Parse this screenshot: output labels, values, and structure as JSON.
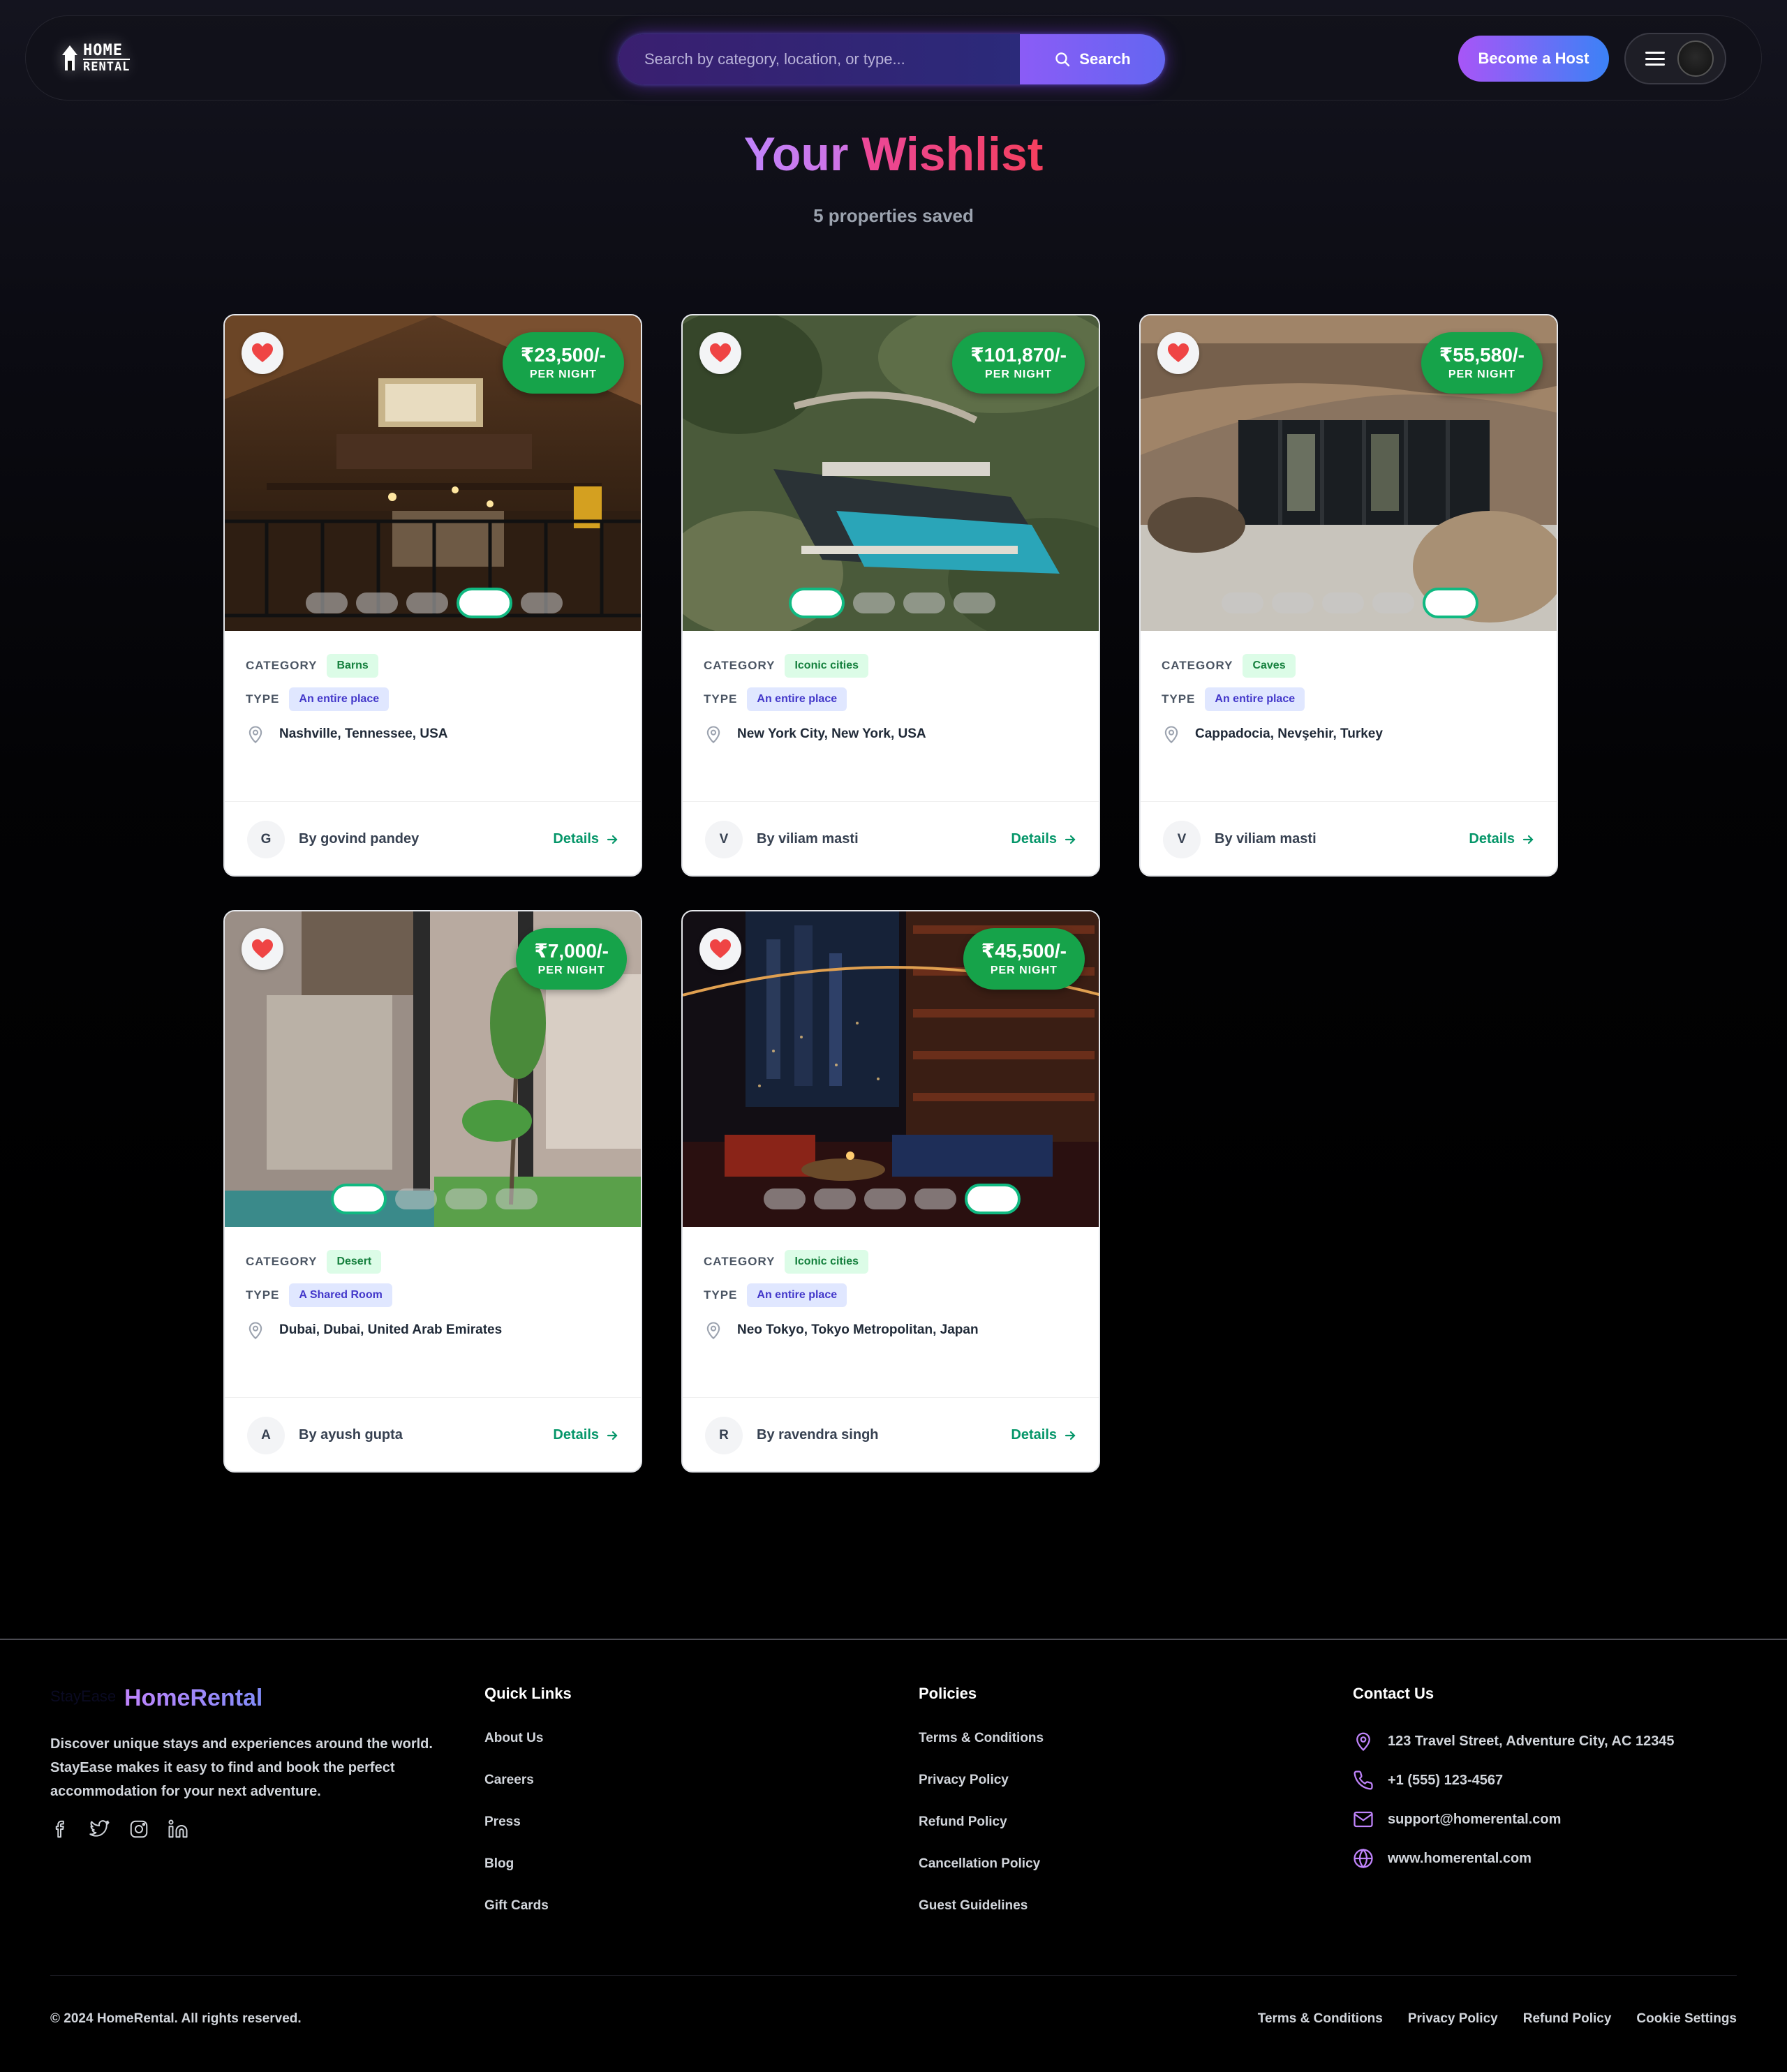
{
  "header": {
    "logo_line1": "HOME",
    "logo_line2": "RENTAL",
    "search_placeholder": "Search by category, location, or type...",
    "search_button": "Search",
    "host_button": "Become a Host"
  },
  "page": {
    "title_part1": "Your ",
    "title_part2": "Wishlist",
    "subtitle": "5 properties saved"
  },
  "labels": {
    "category": "CATEGORY",
    "type": "TYPE",
    "per_night": "PER NIGHT",
    "details": "Details"
  },
  "listings": [
    {
      "price": "₹23,500/-",
      "category": "Barns",
      "type": "An entire place",
      "location": "Nashville, Tennessee, USA",
      "host_initial": "G",
      "host": "By govind pandey",
      "image_theme": "barn-loft-interior",
      "slides": 5,
      "active_slide": 4
    },
    {
      "price": "₹101,870/-",
      "category": "Iconic cities",
      "type": "An entire place",
      "location": "New York City, New York, USA",
      "host_initial": "V",
      "host": "By viliam masti",
      "image_theme": "cliffside-villa-pool",
      "slides": 4,
      "active_slide": 1
    },
    {
      "price": "₹55,580/-",
      "category": "Caves",
      "type": "An entire place",
      "location": "Cappadocia, Nevşehir, Turkey",
      "host_initial": "V",
      "host": "By viliam masti",
      "image_theme": "cave-glass-house",
      "slides": 5,
      "active_slide": 5
    },
    {
      "price": "₹7,000/-",
      "category": "Desert",
      "type": "A Shared Room",
      "location": "Dubai, Dubai, United Arab Emirates",
      "host_initial": "A",
      "host": "By ayush gupta",
      "image_theme": "courtyard-house",
      "slides": 4,
      "active_slide": 1
    },
    {
      "price": "₹45,500/-",
      "category": "Iconic cities",
      "type": "An entire place",
      "location": "Neo Tokyo, Tokyo Metropolitan, Japan",
      "host_initial": "R",
      "host": "By ravendra singh",
      "image_theme": "night-city-library",
      "slides": 5,
      "active_slide": 5
    }
  ],
  "footer": {
    "brand_ghost": "StayEase",
    "brand": "HomeRental",
    "description": "Discover unique stays and experiences around the world. StayEase makes it easy to find and book the perfect accommodation for your next adventure.",
    "socials": [
      "facebook-icon",
      "twitter-icon",
      "instagram-icon",
      "linkedin-icon"
    ],
    "quick_links_title": "Quick Links",
    "quick_links": [
      "About Us",
      "Careers",
      "Press",
      "Blog",
      "Gift Cards"
    ],
    "policies_title": "Policies",
    "policies": [
      "Terms & Conditions",
      "Privacy Policy",
      "Refund Policy",
      "Cancellation Policy",
      "Guest Guidelines"
    ],
    "contact_title": "Contact Us",
    "contact": {
      "address": "123 Travel Street, Adventure City, AC 12345",
      "phone": "+1 (555) 123-4567",
      "email": "support@homerental.com",
      "website": "www.homerental.com"
    },
    "copyright": "© 2024 HomeRental. All rights reserved.",
    "bottom_links": [
      "Terms & Conditions",
      "Privacy Policy",
      "Refund Policy",
      "Cookie Settings"
    ]
  },
  "colors": {
    "accent_purple": "#8b5cf6",
    "accent_blue": "#3b82f6",
    "price_green": "#16a34a",
    "details_green": "#059669",
    "heart_red": "#ef4444"
  }
}
